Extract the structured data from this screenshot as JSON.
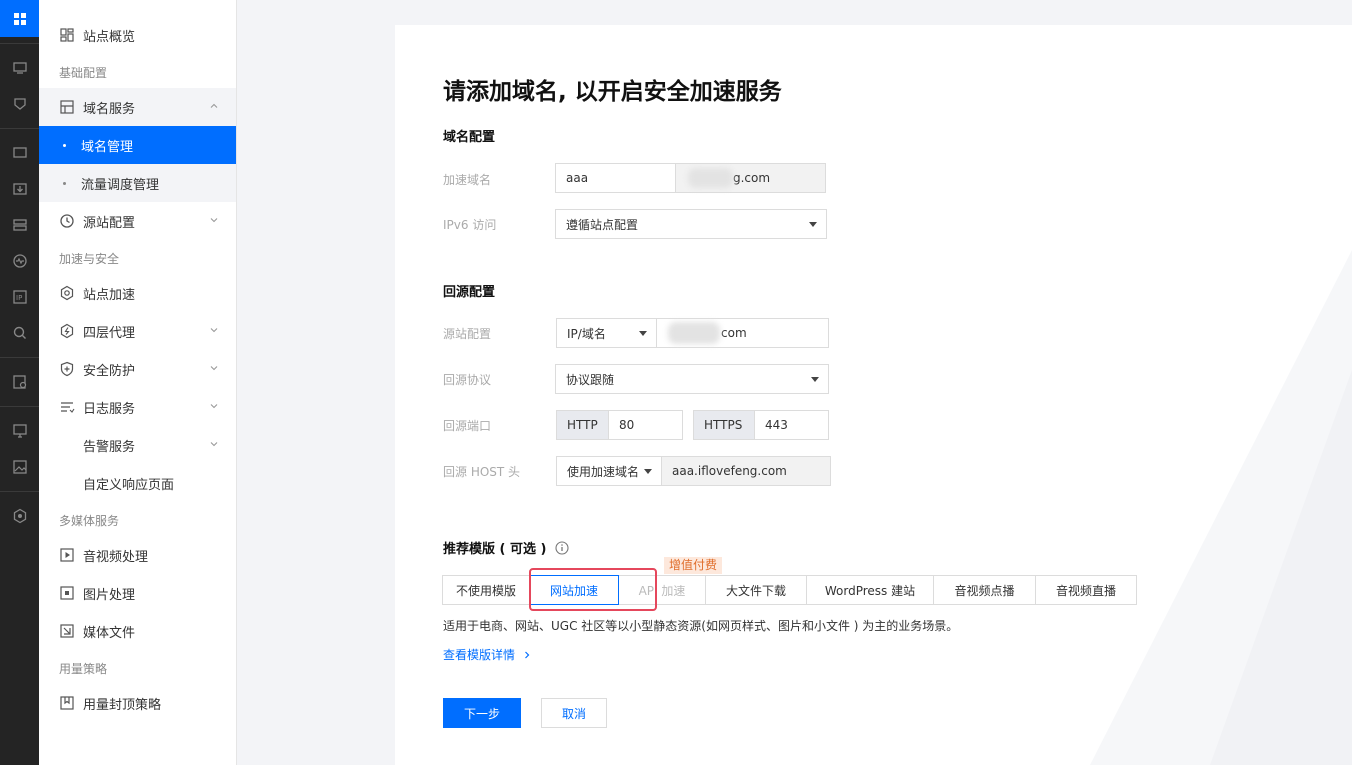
{
  "sidebar": {
    "overview": "站点概览",
    "group_basic": "基础配置",
    "domain_service": "域名服务",
    "domain_manage": "域名管理",
    "traffic_manage": "流量调度管理",
    "origin_config": "源站配置",
    "group_accel": "加速与安全",
    "site_accel": "站点加速",
    "l4_proxy": "四层代理",
    "security": "安全防护",
    "log_service": "日志服务",
    "alarm_service": "告警服务",
    "custom_page": "自定义响应页面",
    "group_media": "多媒体服务",
    "av_process": "音视频处理",
    "image_process": "图片处理",
    "media_files": "媒体文件",
    "group_usage": "用量策略",
    "usage_cap": "用量封顶策略"
  },
  "page": {
    "title": "请添加域名, 以开启安全加速服务",
    "domain_section": "域名配置",
    "accel_domain_label": "加速域名",
    "accel_domain_value": "aaa",
    "accel_domain_suffix": "g.com",
    "ipv6_label": "IPv6 访问",
    "ipv6_value": "遵循站点配置",
    "origin_section": "回源配置",
    "origin_config_label": "源站配置",
    "origin_type": "IP/域名",
    "origin_value": "com",
    "origin_protocol_label": "回源协议",
    "origin_protocol_value": "协议跟随",
    "origin_port_label": "回源端口",
    "http_label": "HTTP",
    "http_port": "80",
    "https_label": "HTTPS",
    "https_port": "443",
    "host_label": "回源 HOST 头",
    "host_type": "使用加速域名",
    "host_value": "aaa.iflovefeng.com",
    "template_section": "推荐模版 ( 可选 )",
    "badge": "增值付费",
    "tabs": [
      "不使用模版",
      "网站加速",
      "API 加速",
      "大文件下载",
      "WordPress 建站",
      "音视频点播",
      "音视频直播"
    ],
    "description": "适用于电商、网站、UGC 社区等以小型静态资源(如网页样式、图片和小文件 ) 为主的业务场景。",
    "detail_link": "查看模版详情",
    "next_button": "下一步",
    "cancel_button": "取消"
  }
}
